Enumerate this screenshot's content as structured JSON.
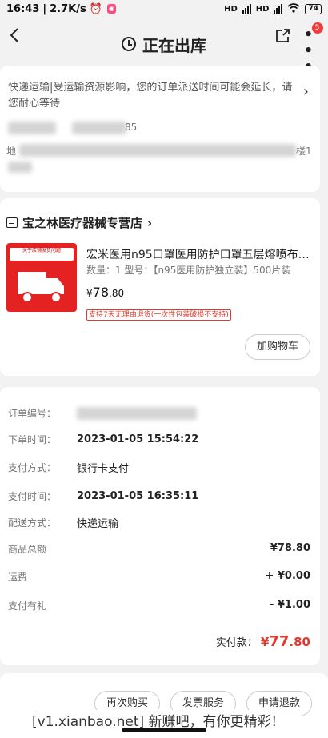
{
  "status_bar": {
    "time": "16:43",
    "speed": "2.7K/s",
    "network_a": "HD",
    "network_b": "HD",
    "battery": "74"
  },
  "header": {
    "title": "正在出库",
    "back_icon": "chevron-left-icon",
    "share_icon": "share-icon",
    "more_icon": "more-icon",
    "more_badge": "5"
  },
  "notice": {
    "text": "快递运输|受运输资源影响，您的订单派送时间可能会延长，请您耐心等待",
    "address_prefix": "地",
    "address_suffix": "楼1",
    "phone_suffix": "85"
  },
  "shop": {
    "name": "宝之林医疗器械专营店",
    "product": {
      "title": "宏米医用n95口罩医用防护口罩五层熔喷布…",
      "spec": "数量：1  型号：【n95医用防护独立装】500片装",
      "price_main": "78",
      "price_cents": ".80",
      "price_symbol": "¥",
      "return_tag": "支持7天无理由退货(一次性包装破损不支持)",
      "image_header": "关于店铺发货问题"
    },
    "add_cart_label": "加购物车"
  },
  "order_info": {
    "order_no_label": "订单编号：",
    "order_time_label": "下单时间：",
    "order_time": "2023-01-05 15:54:22",
    "pay_method_label": "支付方式：",
    "pay_method": "银行卡支付",
    "pay_time_label": "支付时间：",
    "pay_time": "2023-01-05 16:35:11",
    "delivery_label": "配送方式：",
    "delivery": "快递运输"
  },
  "amounts": {
    "goods_total_label": "商品总额",
    "goods_total": "¥78.80",
    "shipping_label": "运费",
    "shipping": "+ ¥0.00",
    "discount_label": "支付有礼",
    "discount": "- ¥1.00",
    "paid_label": "实付款：",
    "paid_symbol": "¥",
    "paid_main": "77",
    "paid_cents": ".80"
  },
  "actions": {
    "rebuy": "再次购买",
    "invoice": "发票服务",
    "refund": "申请退款"
  },
  "watermark": "[v1.xianbao.net] 新赚吧，有你更精彩！",
  "colors": {
    "accent": "#e03a2e",
    "page_bg": "#f2f2f2"
  }
}
